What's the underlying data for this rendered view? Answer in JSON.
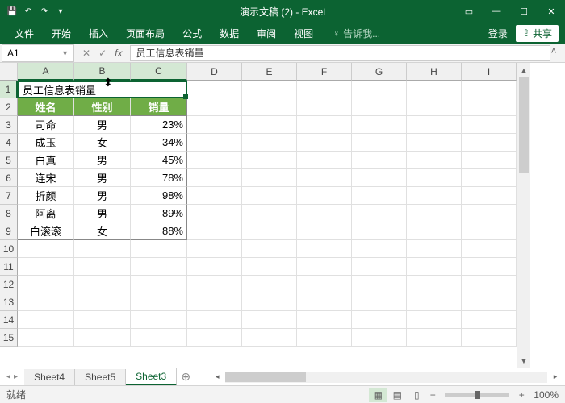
{
  "title": "演示文稿 (2) - Excel",
  "tabs": {
    "file": "文件",
    "home": "开始",
    "insert": "插入",
    "layout": "页面布局",
    "formula": "公式",
    "data": "数据",
    "review": "审阅",
    "view": "视图"
  },
  "tellme": "告诉我...",
  "login": "登录",
  "share": "共享",
  "namebox": "A1",
  "formula_value": "员工信息表销量",
  "cols": [
    "A",
    "B",
    "C",
    "D",
    "E",
    "F",
    "G",
    "H",
    "I"
  ],
  "row1_merged": "员工信息表销量",
  "headers": {
    "name": "姓名",
    "gender": "性别",
    "sales": "销量"
  },
  "rows": [
    {
      "name": "司命",
      "gender": "男",
      "sales": "23%"
    },
    {
      "name": "成玉",
      "gender": "女",
      "sales": "34%"
    },
    {
      "name": "白真",
      "gender": "男",
      "sales": "45%"
    },
    {
      "name": "连宋",
      "gender": "男",
      "sales": "78%"
    },
    {
      "name": "折颜",
      "gender": "男",
      "sales": "98%"
    },
    {
      "name": "阿离",
      "gender": "男",
      "sales": "89%"
    },
    {
      "name": "白滚滚",
      "gender": "女",
      "sales": "88%"
    }
  ],
  "sheets": {
    "s4": "Sheet4",
    "s5": "Sheet5",
    "s3": "Sheet3"
  },
  "status": "就绪",
  "zoom": "100%"
}
